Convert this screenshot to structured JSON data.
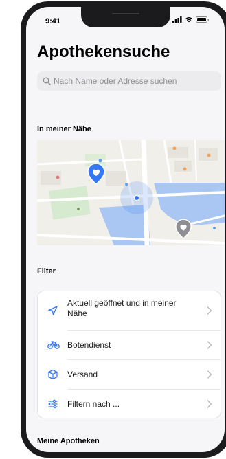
{
  "status_bar": {
    "time": "9:41"
  },
  "page": {
    "title": "Apothekensuche"
  },
  "search": {
    "placeholder": "Nach Name oder Adresse suchen"
  },
  "nearby": {
    "section_title": "In meiner Nähe"
  },
  "filter": {
    "section_title": "Filter",
    "items": [
      {
        "label": "Aktuell geöffnet und in meiner Nähe",
        "icon": "location-arrow-icon"
      },
      {
        "label": "Botendienst",
        "icon": "bicycle-icon"
      },
      {
        "label": "Versand",
        "icon": "package-icon"
      },
      {
        "label": "Filtern nach ...",
        "icon": "sliders-icon"
      }
    ]
  },
  "my_pharmacies": {
    "section_title": "Meine Apotheken"
  },
  "colors": {
    "accent": "#3478f6",
    "background": "#f6f6f8",
    "map_water": "#a9c7f2",
    "pin_blue": "#3478f6",
    "pin_gray": "#8e8e93"
  }
}
